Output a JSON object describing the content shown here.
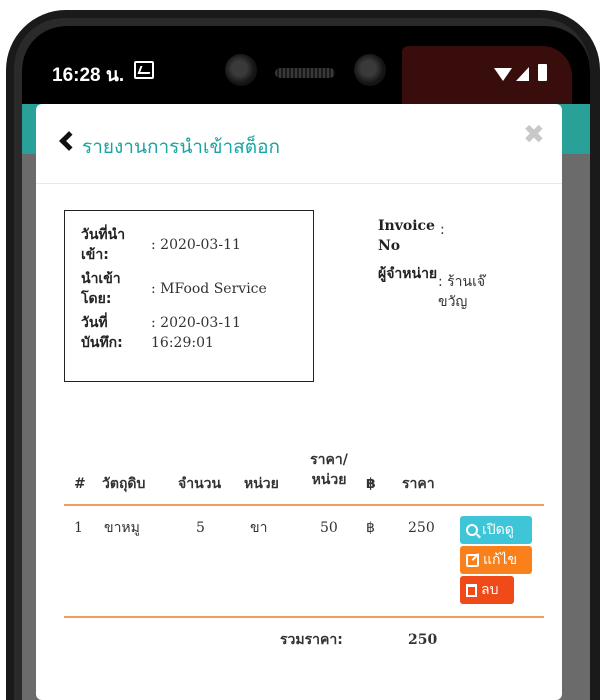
{
  "status_bar": {
    "time": "16:28 น."
  },
  "modal": {
    "title": "รายงานการนำเข้าสต็อก",
    "close_glyph": "✖"
  },
  "details": {
    "import_date_label": "วันที่นำเข้า:",
    "import_date_value": ": 2020-03-11",
    "imported_by_label": "นำเข้าโดย:",
    "imported_by_value": ": MFood Service",
    "record_date_label": "วันที่บันทึก:",
    "record_date_value": ": 2020-03-11 16:29:01",
    "invoice_label": "Invoice No",
    "invoice_value": ":",
    "supplier_label": "ผู้จำหน่าย",
    "supplier_value": ": ร้านเจ๊ขวัญ"
  },
  "table": {
    "headers": {
      "index": "#",
      "ingredient": "วัตถุดิบ",
      "quantity": "จำนวน",
      "unit": "หน่วย",
      "unit_price": "ราคา/หน่วย",
      "currency": "฿",
      "price": "ราคา"
    },
    "rows": [
      {
        "index": "1",
        "ingredient": "ขาหมู",
        "quantity": "5",
        "unit": "ขา",
        "unit_price": "50",
        "currency": "฿",
        "price": "250",
        "view_label": "เปิดดู",
        "edit_label": "แก้ไข",
        "delete_label": "ลบ"
      }
    ],
    "total_label": "รวมราคา:",
    "total_value": "250"
  },
  "icons": {
    "back": "chevron-left-icon",
    "close": "close-icon",
    "view": "search-icon",
    "edit": "edit-icon",
    "delete": "trash-icon"
  },
  "colors": {
    "title": "#1aa3a3",
    "view_button": "#3ec6d8",
    "edit_button": "#f9801b",
    "delete_button": "#ef4a17",
    "divider": "#f39c5a",
    "header_strip": "#2aa198"
  }
}
